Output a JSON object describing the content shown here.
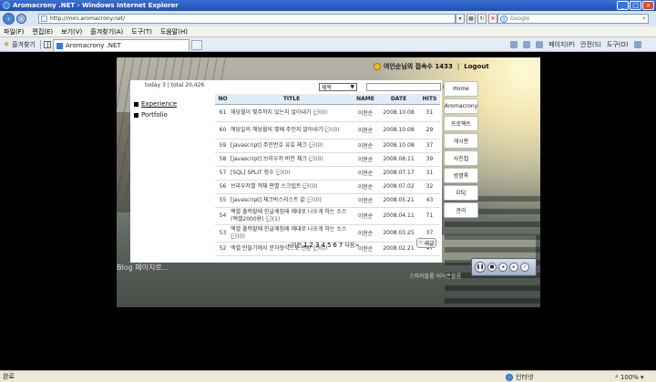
{
  "window": {
    "title": "Aromacrony .NET - Windows Internet Explorer"
  },
  "address": {
    "url": "http://mini.aromacrony.net/",
    "search_placeholder": "Google"
  },
  "menu": [
    "파일(F)",
    "편집(E)",
    "보기(V)",
    "즐겨찾기(A)",
    "도구(T)",
    "도움말(H)"
  ],
  "favorites_label": "즐겨찾기",
  "tab": {
    "title": "Aromacrony .NET"
  },
  "tools": {
    "home": "",
    "page": "페이지(P)",
    "safety": "안전(S)",
    "tools": "도구(O)"
  },
  "header": {
    "greeting": "여인순님의 접속수 1433",
    "separator": "|",
    "logout": "Logout"
  },
  "stats": {
    "text": "today 3 | total 20,426"
  },
  "nav": [
    {
      "label": "Experience"
    },
    {
      "label": "Portfolio"
    }
  ],
  "search": {
    "select_value": "제목"
  },
  "board": {
    "columns": [
      "NO",
      "TITLE",
      "NAME",
      "DATE",
      "HITS"
    ],
    "rows": [
      {
        "no": "61",
        "title": "해당월이 몇주까지 있는지 알아내기",
        "comments": "(0)",
        "name": "이현순",
        "date": "2008.10.08",
        "hits": "31"
      },
      {
        "no": "60",
        "title": "해당일의 해당월의 몇째 주인지 알아내기",
        "comments": "(0)",
        "name": "이현순",
        "date": "2008.10.08",
        "hits": "29"
      },
      {
        "no": "59",
        "title": "[javascript] 주민번호 유효 체크",
        "comments": "(0)",
        "name": "이현순",
        "date": "2008.10.08",
        "hits": "37"
      },
      {
        "no": "58",
        "title": "[javascript] 브라우저 버전 체크",
        "comments": "(0)",
        "name": "이현순",
        "date": "2008.08.11",
        "hits": "39"
      },
      {
        "no": "57",
        "title": "[SQL] SPLIT 함수",
        "comments": "(0)",
        "name": "이현순",
        "date": "2008.07.17",
        "hits": "31"
      },
      {
        "no": "56",
        "title": "브라우저별 객체 판별 스크립트",
        "comments": "(0)",
        "name": "이현순",
        "date": "2008.07.02",
        "hits": "32"
      },
      {
        "no": "55",
        "title": "[javascript] 체크박스리스트 값",
        "comments": "(0)",
        "name": "이현순",
        "date": "2008.05.21",
        "hits": "43"
      },
      {
        "no": "54",
        "title": "엑셀 출력할때 한글깨짐때 제대로 나오게 하는 소스(엑셀2000용)",
        "comments": "(1)",
        "name": "이현순",
        "date": "2008.04.11",
        "hits": "71"
      },
      {
        "no": "53",
        "title": "엑셀 출력할때 한글깨짐때 제대로 나오게 하는 소스",
        "comments": "(0)",
        "name": "이현순",
        "date": "2008.03.25",
        "hits": "37"
      },
      {
        "no": "52",
        "title": "엑셀 만들기에서 문자형식으로 변환",
        "comments": "(0)",
        "name": "이현순",
        "date": "2008.02.21",
        "hits": "47"
      }
    ]
  },
  "pager": {
    "prev": "<이전",
    "pages": [
      "1",
      "2",
      "3",
      "4",
      "5",
      "6",
      "7"
    ],
    "next": "다음>"
  },
  "write_label": "새글",
  "sidemenu": [
    "Home",
    "Aromacrony",
    "프로젝트",
    "게시판",
    "사진첩",
    "방명록",
    "DSJ",
    "관리"
  ],
  "footer": {
    "blog_link": "Blog 페이지로...",
    "speaker": "스피커볼륨 이어폰볼륨"
  },
  "status": {
    "text": "완료",
    "zone": "인터넷",
    "zoom": "100%"
  }
}
